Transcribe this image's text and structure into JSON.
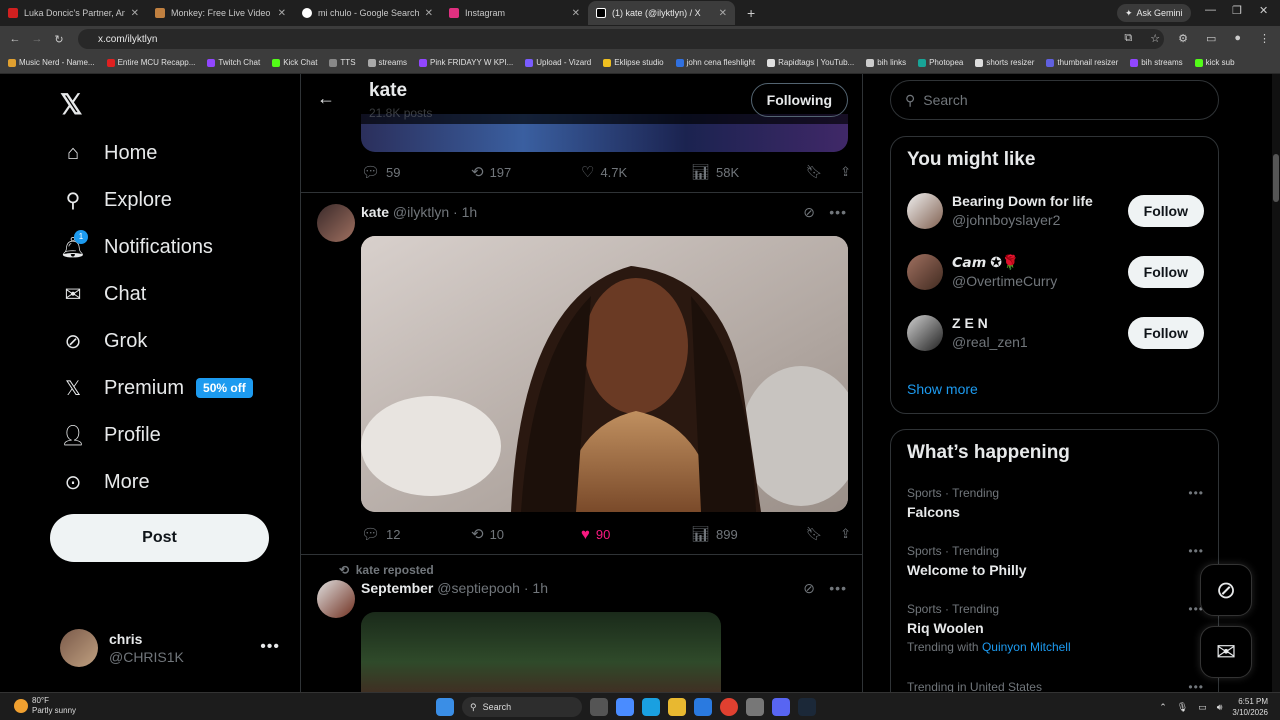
{
  "browser": {
    "tabs": [
      {
        "title": "Luka Doncic's Partner, Anamaria",
        "color": "#d02020"
      },
      {
        "title": "Monkey: Free Live Video Chat",
        "color": "#c08040"
      },
      {
        "title": "mi chulo - Google Search",
        "color": "#ffffff"
      },
      {
        "title": "Instagram",
        "color": "#e03080"
      },
      {
        "title": "(1) kate (@ilyktlyn) / X",
        "color": "#ffffff"
      }
    ],
    "new_tab": "+",
    "ask_gemini": "Ask Gemini",
    "url": "x.com/ilyktlyn",
    "bookmarks": [
      {
        "label": "Music Nerd - Name...",
        "color": "#e0a030"
      },
      {
        "label": "Entire MCU Recapp...",
        "color": "#e02020"
      },
      {
        "label": "Twitch Chat",
        "color": "#9146ff"
      },
      {
        "label": "Kick Chat",
        "color": "#53fc18"
      },
      {
        "label": "TTS",
        "color": "#888888"
      },
      {
        "label": "streams",
        "color": "#aaaaaa"
      },
      {
        "label": "Pink FRIDAYY W KPI...",
        "color": "#9146ff"
      },
      {
        "label": "Upload - Vizard",
        "color": "#7a5cff"
      },
      {
        "label": "Eklipse studio",
        "color": "#f0c020"
      },
      {
        "label": "john cena fleshlight",
        "color": "#3070e0"
      },
      {
        "label": "Rapidtags | YouTub...",
        "color": "#e0e0e0"
      },
      {
        "label": "bih links",
        "color": "#cccccc"
      },
      {
        "label": "Photopea",
        "color": "#18a497"
      },
      {
        "label": "shorts resizer",
        "color": "#dddddd"
      },
      {
        "label": "thumbnail resizer",
        "color": "#6060e0"
      },
      {
        "label": "bih streams",
        "color": "#9146ff"
      },
      {
        "label": "kick sub",
        "color": "#53fc18"
      }
    ]
  },
  "nav": {
    "home": "Home",
    "explore": "Explore",
    "notifications": "Notifications",
    "notifications_badge": "1",
    "chat": "Chat",
    "grok": "Grok",
    "premium": "Premium",
    "premium_promo": "50% off",
    "profile": "Profile",
    "more": "More",
    "post": "Post",
    "account_name": "chris",
    "account_handle": "@CHRIS1K"
  },
  "profile_header": {
    "name": "kate",
    "posts": "21.8K posts",
    "following_label": "Following"
  },
  "feed": {
    "prev_post_stats": {
      "replies": "59",
      "reposts": "197",
      "likes": "4.7K",
      "views": "58K"
    },
    "post1": {
      "name": "kate",
      "handle": "@ilyktlyn",
      "time": "· 1h",
      "stats": {
        "replies": "12",
        "reposts": "10",
        "likes": "90",
        "views": "899"
      },
      "liked": true
    },
    "post2": {
      "repost_label": "kate reposted",
      "name": "September",
      "handle": "@septiepooh",
      "time": "· 1h"
    }
  },
  "right": {
    "search_placeholder": "Search",
    "you_might_like": "You might like",
    "suggestions": [
      {
        "name": "Bearing Down for life",
        "handle": "@johnboyslayer2",
        "button": "Follow"
      },
      {
        "name": "𝘾𝙖𝙢 ✪🌹",
        "handle": "@OvertimeCurry",
        "button": "Follow"
      },
      {
        "name": "Z E N",
        "handle": "@real_zen1",
        "button": "Follow"
      }
    ],
    "show_more": "Show more",
    "whats_happening": "What’s happening",
    "trends": [
      {
        "context": "Sports · Trending",
        "title": "Falcons",
        "with": ""
      },
      {
        "context": "Sports · Trending",
        "title": "Welcome to Philly",
        "with": ""
      },
      {
        "context": "Sports · Trending",
        "title": "Riq Woolen",
        "with_label": "Trending with",
        "with": "Quinyon Mitchell"
      },
      {
        "context": "Trending in United States",
        "title": "",
        "with": ""
      }
    ]
  },
  "taskbar": {
    "temp": "80°F",
    "weather": "Partly sunny",
    "search": "Search",
    "time": "6:51 PM",
    "date": "3/10/2026"
  },
  "colors": {
    "accent": "#1d9bf0",
    "like": "#f91880",
    "bg": "#000000",
    "border": "#2f3336"
  }
}
